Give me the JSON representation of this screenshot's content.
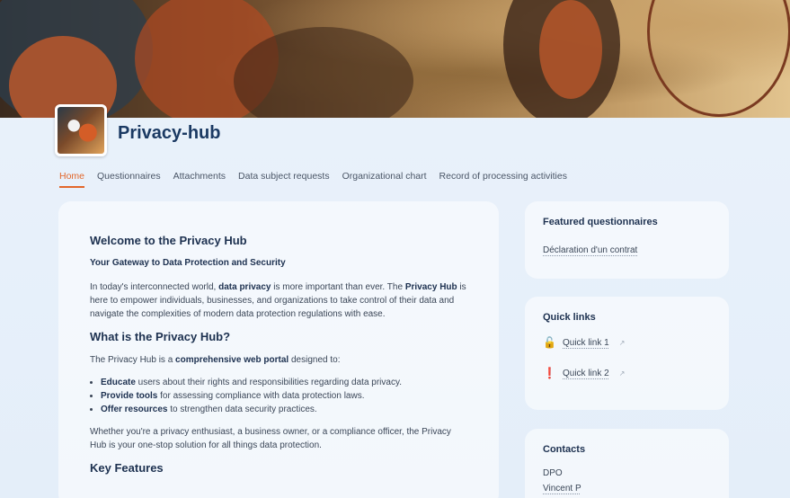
{
  "site": {
    "title": "Privacy-hub"
  },
  "nav": [
    {
      "label": "Home",
      "active": true
    },
    {
      "label": "Questionnaires"
    },
    {
      "label": "Attachments"
    },
    {
      "label": "Data subject requests"
    },
    {
      "label": "Organizational chart"
    },
    {
      "label": "Record of processing activities"
    }
  ],
  "main": {
    "heading": "Welcome to the Privacy Hub",
    "subheading": "Your Gateway to Data Protection and Security",
    "intro": {
      "t1": "In today's interconnected world, ",
      "b1": "data privacy",
      "t2": " is more important than ever. The ",
      "b2": "Privacy Hub",
      "t3": " is here to empower individuals, businesses, and organizations to take control of their data and navigate the complexities of modern data protection regulations with ease."
    },
    "what_heading": "What is the Privacy Hub?",
    "what_text": {
      "t1": "The Privacy Hub is a ",
      "b1": "comprehensive web portal",
      "t2": " designed to:"
    },
    "features": [
      {
        "bold": "Educate",
        "text": " users about their rights and responsibilities regarding data privacy."
      },
      {
        "bold": "Provide tools",
        "text": " for assessing compliance with data protection laws."
      },
      {
        "bold": "Offer resources",
        "text": " to strengthen data security practices."
      }
    ],
    "closing": "Whether you're a privacy enthusiast, a business owner, or a compliance officer, the Privacy Hub is your one-stop solution for all things data protection.",
    "key_heading": "Key Features"
  },
  "featured": {
    "title": "Featured questionnaires",
    "items": [
      "Déclaration d'un contrat"
    ]
  },
  "quicklinks": {
    "title": "Quick links",
    "items": [
      {
        "label": "Quick link 1",
        "icon": "unlocked-padlock-icon",
        "glyph": "🔓"
      },
      {
        "label": "Quick link 2",
        "icon": "exclamation-icon",
        "glyph": "❗"
      }
    ]
  },
  "contacts": {
    "title": "Contacts",
    "role": "DPO",
    "name": "Vincent P"
  },
  "colors": {
    "accent": "#e2662a",
    "title": "#1b3a63"
  }
}
